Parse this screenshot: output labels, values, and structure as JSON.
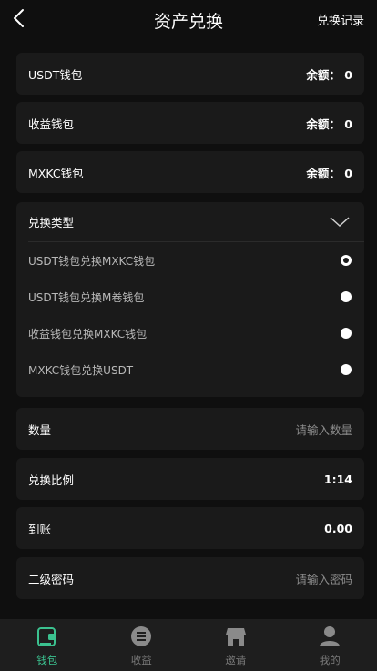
{
  "header": {
    "title": "资产兑换",
    "history_label": "兑换记录"
  },
  "wallets": [
    {
      "label": "USDT钱包",
      "balance_label": "余额：",
      "balance": "0"
    },
    {
      "label": "收益钱包",
      "balance_label": "余额：",
      "balance": "0"
    },
    {
      "label": "MXKC钱包",
      "balance_label": "余额：",
      "balance": "0"
    }
  ],
  "exchange_type": {
    "label": "兑换类型",
    "options": [
      {
        "label": "USDT钱包兑换MXKC钱包",
        "selected": true
      },
      {
        "label": "USDT钱包兑换M卷钱包",
        "selected": false
      },
      {
        "label": "收益钱包兑换MXKC钱包",
        "selected": false
      },
      {
        "label": "MXKC钱包兑换USDT",
        "selected": false
      }
    ]
  },
  "form": {
    "quantity_label": "数量",
    "quantity_placeholder": "请输入数量",
    "ratio_label": "兑换比例",
    "ratio_value": "1:14",
    "arrival_label": "到账",
    "arrival_value": "0.00",
    "password_label": "二级密码",
    "password_placeholder": "请输入密码"
  },
  "nav": {
    "active_color": "#3bc18f",
    "items": [
      {
        "label": "钱包",
        "icon": "wallet-icon",
        "active": true
      },
      {
        "label": "收益",
        "icon": "list-icon",
        "active": false
      },
      {
        "label": "邀请",
        "icon": "store-icon",
        "active": false
      },
      {
        "label": "我的",
        "icon": "user-icon",
        "active": false
      }
    ]
  }
}
